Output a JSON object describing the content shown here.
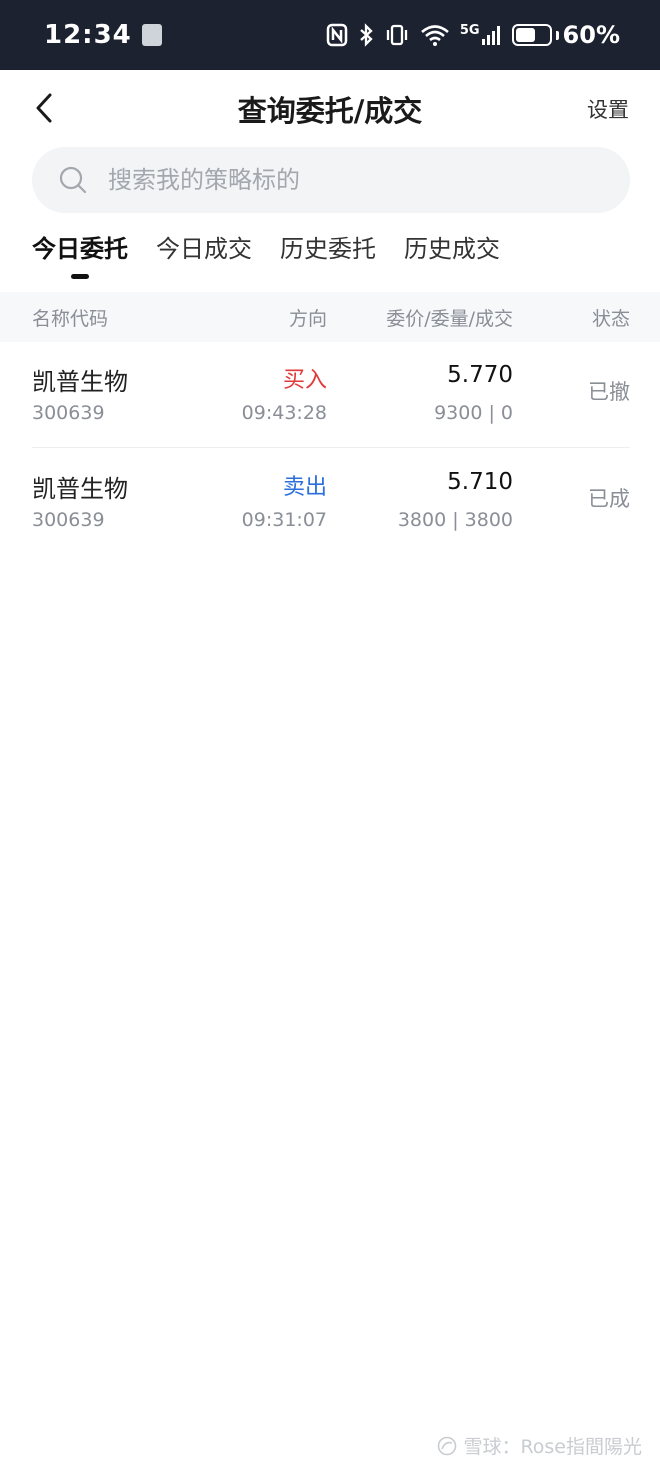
{
  "status_bar": {
    "time": "12:34",
    "indicators": [
      "nfc-icon",
      "bluetooth-icon",
      "vibrate-icon",
      "wifi-icon",
      "signal-5g-icon"
    ],
    "network": "5G",
    "battery_percent": "60%",
    "battery_level": 0.6
  },
  "nav": {
    "title": "查询委托/成交",
    "settings_label": "设置"
  },
  "search": {
    "placeholder": "搜索我的策略标的"
  },
  "tabs": [
    {
      "label": "今日委托",
      "active": true
    },
    {
      "label": "今日成交",
      "active": false
    },
    {
      "label": "历史委托",
      "active": false
    },
    {
      "label": "历史成交",
      "active": false
    }
  ],
  "table": {
    "headers": {
      "name_code": "名称代码",
      "direction": "方向",
      "price_qty": "委价/委量/成交",
      "status": "状态"
    },
    "rows": [
      {
        "name": "凯普生物",
        "code": "300639",
        "direction": "买入",
        "time": "09:43:28",
        "price": "5.770",
        "qty": "9300 | 0",
        "status": "已撤"
      },
      {
        "name": "凯普生物",
        "code": "300639",
        "direction": "卖出",
        "time": "09:31:07",
        "price": "5.710",
        "qty": "3800 | 3800",
        "status": "已成"
      }
    ]
  },
  "colors": {
    "buy": "#e03a3a",
    "sell": "#2a6fdb",
    "status_bar_bg": "#1d2230"
  },
  "watermark": {
    "text": "雪球：Rose指間陽光"
  }
}
